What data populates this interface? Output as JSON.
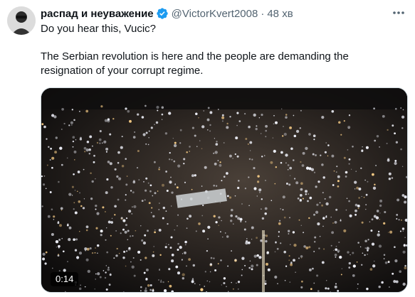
{
  "author": {
    "display_name": "распад и неуважение",
    "handle": "@VictorKvert2008",
    "separator": "·",
    "time": "48 хв",
    "verified": true
  },
  "icons": {
    "verified": "verified-badge-icon",
    "more": "more-options-icon"
  },
  "tweet": {
    "line1": "Do you hear this, Vucic?",
    "line2": "The Serbian revolution is here and the people are demanding the resignation of your corrupt regime."
  },
  "media": {
    "type": "video",
    "duration": "0:14"
  },
  "colors": {
    "verified_blue": "#1d9bf0",
    "secondary_text": "#536471",
    "primary_text": "#0f1419"
  }
}
